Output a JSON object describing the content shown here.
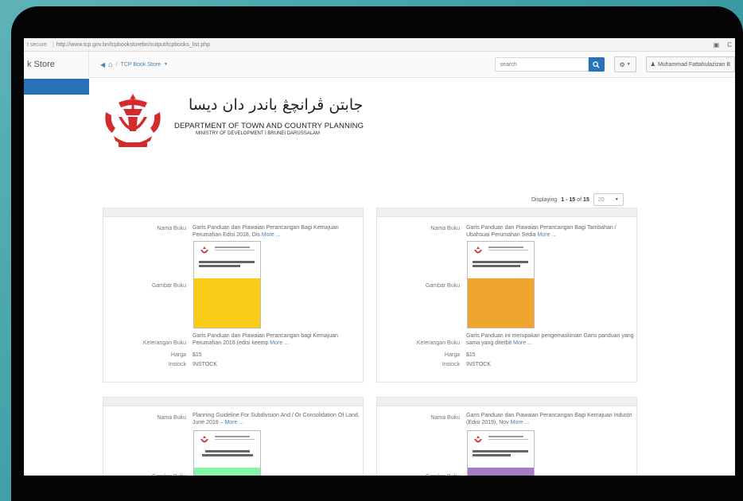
{
  "browser": {
    "secure_label": "t secure",
    "url": "http://www.tcp.gov.bn/tcpbookstorebn/output/tcpbooks_list.php"
  },
  "app": {
    "brand": "k Store",
    "breadcrumb": "TCP Book Store",
    "search_placeholder": "search",
    "user_name": "Muhammad Fattahulazizan B"
  },
  "header": {
    "jawi_title": "جابتن ڤرانچڠ باندر دان ديسا",
    "department": "DEPARTMENT OF TOWN AND COUNTRY PLANNING",
    "ministry": "MINISTRY OF DEVELOPMENT I BRUNEI DARUSSALAM"
  },
  "pagination": {
    "prefix": "Displaying",
    "range": "1 - 15",
    "of_label": "of",
    "total": "15",
    "per_page": "20"
  },
  "labels": {
    "nama": "Nama Buku",
    "gambar": "Gambar Buku",
    "keterangan": "Keterangan Buku",
    "harga": "Harga",
    "instock": "Instock",
    "more": "More ..."
  },
  "colors": {
    "accent": "#2a72b7",
    "link": "#4a7fb5"
  },
  "books": [
    {
      "nama": "Garis Panduan dan Piawaian Perancangan Bagi Kemajuan Perumahan Edisi 2018, Dis",
      "keterangan": "Garis Panduan dan Piawaian Perancangan bagi Kemajuan Perumahan 2018 (edisi keemp",
      "harga": "$15",
      "instock": "INSTOCK",
      "cover_color": "#f9cd17"
    },
    {
      "nama": "Garis Panduan dan Piawaian Perancangan Bagi Tambahan / Ubahsuai Perumahan Sedia",
      "keterangan": "Garis Panduan ini merupakan pengemaskinian Garis panduan yang sama yang diterbit",
      "harga": "$15",
      "instock": "INSTOCK",
      "cover_color": "#f0a52f"
    },
    {
      "nama": "Planning Guideline For Subdivision And / Or Consolidation Of Land, June 2019 –",
      "cover_color": "#86f5ab"
    },
    {
      "nama": "Garis Panduan dan Piawaian Perancangan Bagi Kemajuan Industri (Edisi 2019), Nov",
      "cover_color": "#a57cc6"
    }
  ]
}
